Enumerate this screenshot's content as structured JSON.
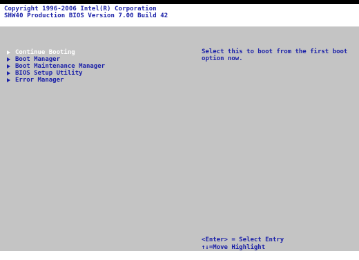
{
  "header": {
    "copyright": "Copyright 1996-2006 Intel(R) Corporation",
    "version": "SHW40 Production BIOS Version 7.00 Build 42"
  },
  "menu": {
    "items": [
      {
        "label": "Continue Booting",
        "selected": true
      },
      {
        "label": "Boot Manager",
        "selected": false
      },
      {
        "label": "Boot Maintenance Manager",
        "selected": false
      },
      {
        "label": "BIOS Setup Utility",
        "selected": false
      },
      {
        "label": "Error Manager",
        "selected": false
      }
    ]
  },
  "help": {
    "text": "Select this to boot from the first boot option now."
  },
  "keys": {
    "enter": "<Enter> = Select Entry",
    "move": "↑↓=Move Highlight"
  },
  "colors": {
    "text": "#1a20a8",
    "selected": "#ffffff",
    "panel": "#c4c4c4"
  }
}
